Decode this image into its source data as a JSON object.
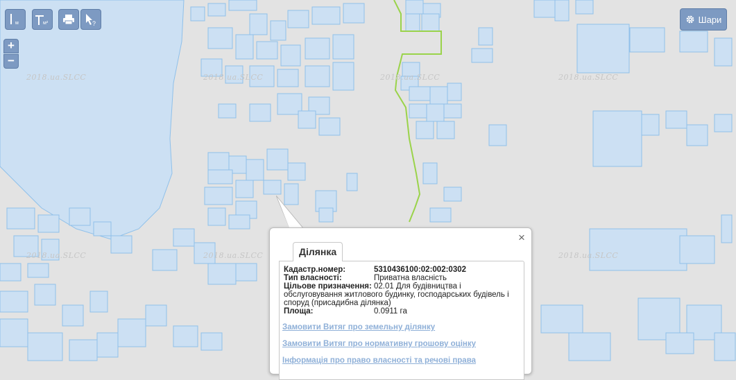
{
  "map": {
    "watermark": "2018.ua.SLCC"
  },
  "toolbar": {
    "measure_line_icon": "ruler-line-icon",
    "measure_area_icon": "ruler-area-icon",
    "print_icon": "printer-icon",
    "identify_icon": "cursor-question-icon",
    "zoom_in_label": "+",
    "zoom_out_label": "−"
  },
  "layers_button": {
    "label": "Шари",
    "icon": "gear-icon"
  },
  "popup": {
    "tab_label": "Ділянка",
    "close_label": "×",
    "fields": {
      "cadastral_label": "Кадастр.номер:",
      "cadastral_value": "5310436100:02:002:0302",
      "ownership_label": "Тип власності:",
      "ownership_value": "Приватна власність",
      "purpose_label": "Цільове призначення:",
      "purpose_value": "02.01 Для будівництва і",
      "purpose_value_cont1": "обслуговування житлового будинку, господарських будівель і",
      "purpose_value_cont2": "споруд (присадибна ділянка)",
      "area_label": "Площа:",
      "area_value": "0.0911 га"
    },
    "links": {
      "extract_land": "Замовити Витяг про земельну ділянку",
      "extract_valuation": "Замовити Витяг про нормативну грошову оцінку",
      "ownership_info": "Інформація про право власності та речові права"
    }
  },
  "colors": {
    "background": "#e3e3e3",
    "parcel_fill": "#cce0f3",
    "parcel_stroke": "#8fc0ea",
    "boundary_line": "#9ad34a",
    "control": "#7d9ac2"
  }
}
